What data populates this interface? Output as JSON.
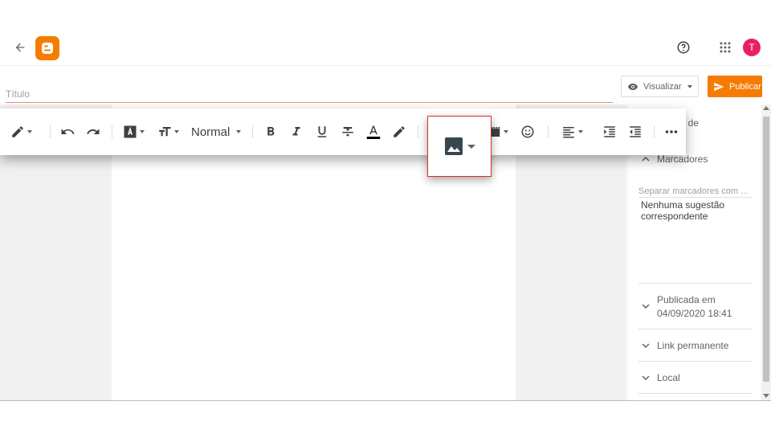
{
  "title_input": {
    "placeholder": "Título",
    "value": ""
  },
  "header": {
    "preview_label": "Visualizar",
    "publish_label": "Publicar",
    "avatar_initial": "T"
  },
  "toolbar": {
    "paragraph_style": "Normal"
  },
  "sidebar": {
    "section_options_partial": "...ções de",
    "tags_title": "Marcadores",
    "tags_placeholder": "Separar marcadores com ...",
    "no_suggestions": "Nenhuma sugestão correspondente",
    "published_label": "Publicada em",
    "published_date": "04/09/2020 18:41",
    "permalink_label": "Link permanente",
    "location_label": "Local"
  },
  "colors": {
    "accent": "#f57c00",
    "avatar": "#e91e63",
    "title_underline": "#f28b82",
    "highlight_border": "#d93025"
  }
}
